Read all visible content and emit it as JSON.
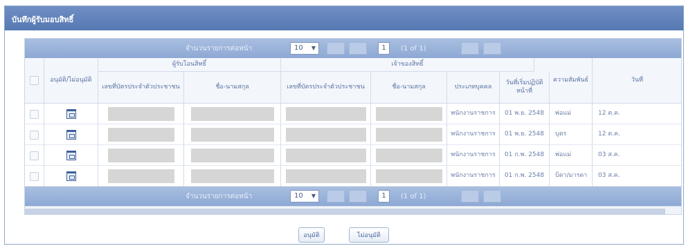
{
  "window": {
    "title": "บันทึกผู้รับมอบสิทธิ์"
  },
  "pager": {
    "label": "จำนวนรายการต่อหน้า",
    "page_size": "10",
    "page_size_arrow": "▼",
    "page": "1",
    "page_info": "(1 of 1)"
  },
  "columns": {
    "approve": "อนุมัติ/ไม่อนุมัติ",
    "grantee_group": "ผู้รับโอนสิทธิ์",
    "grantee_id": "เลขที่บัตรประจำตัวประชาชน",
    "grantee_name": "ชื่อ-นามสกุล",
    "owner_group": "เจ้าของสิทธิ์",
    "owner_id": "เลขที่บัตรประจำตัวประชาชน",
    "owner_name": "ชื่อ-นามสกุล",
    "person_type": "ประเภทบุคคล",
    "effective_date": "วันที่เริ่มปฏิบัติหน้าที่",
    "relationship": "ความสัมพันธ์",
    "date_cut": "วันที่"
  },
  "rows": [
    {
      "person_type": "พนักงานราชการ",
      "effective_date": "01 พ.ย. 2548",
      "relationship": "พ่อแม่",
      "date_cut": "12 ต.ค."
    },
    {
      "person_type": "พนักงานราชการ",
      "effective_date": "01 พ.ย. 2548",
      "relationship": "บุตร",
      "date_cut": "12 ต.ค."
    },
    {
      "person_type": "พนักงานราชการ",
      "effective_date": "01 ก.พ. 2548",
      "relationship": "พ่อแม่",
      "date_cut": "03 ส.ค."
    },
    {
      "person_type": "พนักงานราชการ",
      "effective_date": "01 ก.พ. 2548",
      "relationship": "บิดา/มารดา",
      "date_cut": "03 ส.ค."
    }
  ],
  "actions": {
    "approve": "อนุมัติ",
    "reject": "ไม่อนุมัติ"
  }
}
